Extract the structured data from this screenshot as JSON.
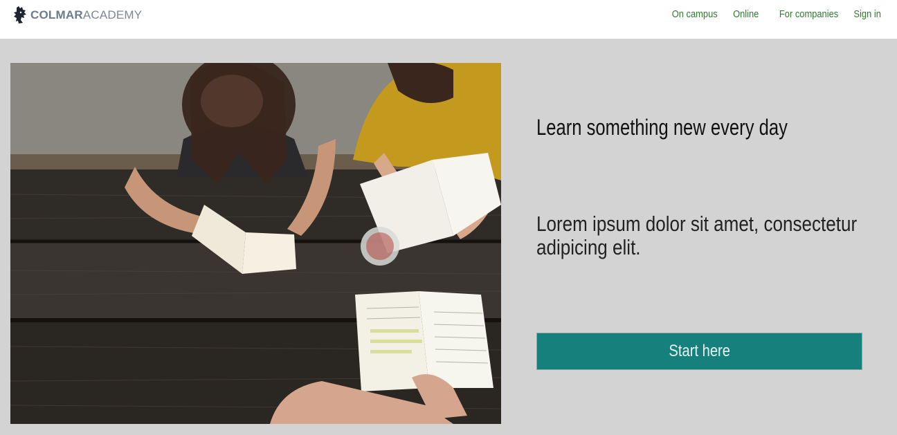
{
  "brand": {
    "name_bold": "COLMAR",
    "name_light": "ACADEMY",
    "icon": "lion-crest-icon"
  },
  "nav": {
    "items": [
      {
        "label": "On campus"
      },
      {
        "label": "Online"
      },
      {
        "label": "For companies"
      },
      {
        "label": "Sign in"
      }
    ]
  },
  "hero": {
    "image": "students-reading-at-wooden-table",
    "headline": "Learn something new every day",
    "lead": "Lorem ipsum dolor sit amet, consectetur adipicing elit.",
    "cta_label": "Start here"
  },
  "colors": {
    "background": "#d3d3d3",
    "header": "#ffffff",
    "nav_link": "#2f7a2f",
    "cta": "#16817c"
  }
}
